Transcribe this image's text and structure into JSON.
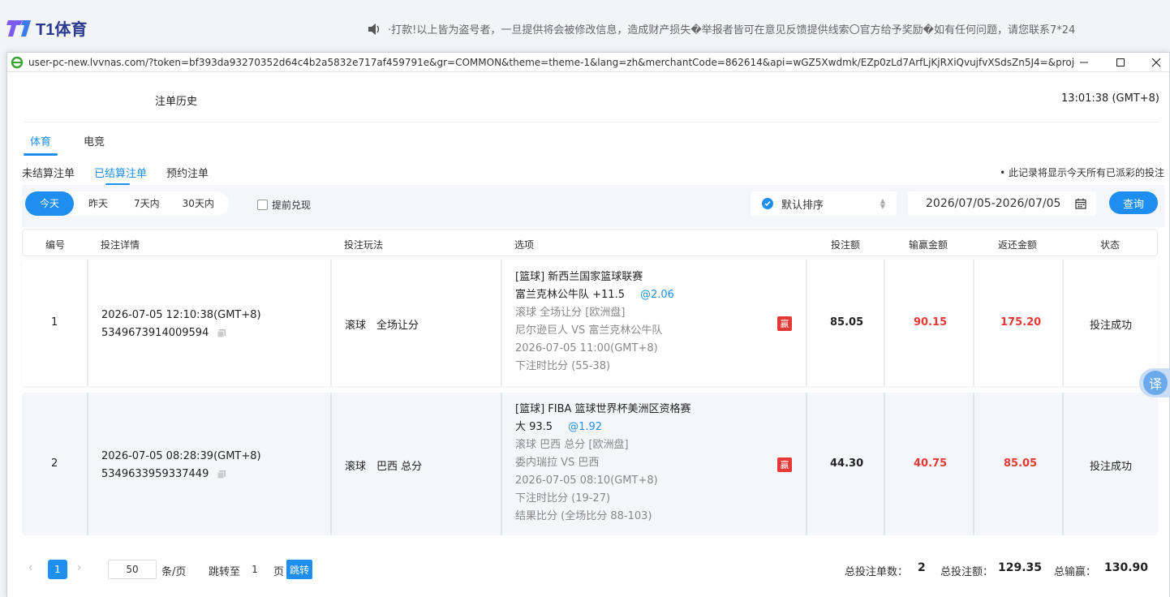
{
  "site": {
    "logo_text": "T1体育",
    "notice": "·打款!以上皆为盗号者，一旦提供将会被修改信息，造成财产损失�举报者皆可在意见反馈提供线索〇官方给予奖励�如有任何问题，请您联系7*24"
  },
  "window": {
    "url": "user-pc-new.lvvnas.com/?token=bf393da93270352d64c4b2a5832e717af459791e&gr=COMMON&theme=theme-1&lang=zh&merchantCode=862614&api=wGZ5Xwdmk/EZp0zLd7ArfLjKjRXiQvujfvXSdsZn5J4=&project=n..."
  },
  "page": {
    "title": "注单历史",
    "clock": "13:01:38 (GMT+8)",
    "main_tabs": [
      "体育",
      "电竞"
    ],
    "sub_tabs": [
      "未结算注单",
      "已结算注单",
      "预约注单"
    ],
    "hint": "• 此记录将显示今天所有已派彩的投注"
  },
  "filters": {
    "ranges": [
      "今天",
      "昨天",
      "7天内",
      "30天内"
    ],
    "early_cashout": "提前兑现",
    "sort": "默认排序",
    "date_range": "2026/07/05-2026/07/05",
    "query": "查询"
  },
  "table": {
    "headers": [
      "编号",
      "投注详情",
      "投注玩法",
      "选项",
      "投注额",
      "输赢金额",
      "返还金额",
      "状态"
    ],
    "rows": [
      {
        "no": "1",
        "time": "2026-07-05 12:10:38(GMT+8)",
        "order_id": "5349673914009594",
        "play": "滚球　全场让分",
        "league": "[篮球] 新西兰国家篮球联赛",
        "pick": "富兰克林公牛队 +11.5",
        "odds": "@2.06",
        "market": "滚球 全场让分 [欧洲盘]",
        "match": "尼尔逊巨人 VS 富兰克林公牛队",
        "match_time": "2026-07-05 11:00(GMT+8)",
        "score_at_bet": "下注时比分 (55-38)",
        "result_score": "",
        "badge": "赢",
        "stake": "85.05",
        "win_loss": "90.15",
        "return": "175.20",
        "status": "投注成功"
      },
      {
        "no": "2",
        "time": "2026-07-05 08:28:39(GMT+8)",
        "order_id": "5349633959337449",
        "play": "滚球　巴西 总分",
        "league": "[篮球] FIBA 篮球世界杯美洲区资格赛",
        "pick": "大 93.5",
        "odds": "@1.92",
        "market": "滚球 巴西 总分 [欧洲盘]",
        "match": "委内瑞拉 VS 巴西",
        "match_time": "2026-07-05 08:10(GMT+8)",
        "score_at_bet": "下注时比分 (19-27)",
        "result_score": "结果比分 (全场比分 88-103)",
        "badge": "赢",
        "stake": "44.30",
        "win_loss": "40.75",
        "return": "85.05",
        "status": "投注成功"
      }
    ]
  },
  "footer": {
    "current_page": "1",
    "page_size": "50",
    "per_page_label": "条/页",
    "jump_label": "跳转至",
    "jump_value": "1",
    "page_unit": "页",
    "jump_button": "跳转",
    "total_count_label": "总投注单数：",
    "total_count": "2",
    "total_stake_label": "总投注额：",
    "total_stake": "129.35",
    "total_win_label": "总输赢：",
    "total_win": "130.90"
  },
  "translate_label": "译",
  "colors": {
    "accent": "#1f8ef1",
    "win_red": "#e53935"
  },
  "icons": [
    "speaker-icon",
    "ie-icon",
    "minimize-icon",
    "maximize-icon",
    "close-icon",
    "check-icon",
    "calendar-icon",
    "copy-icon",
    "chevron-left-icon",
    "chevron-right-icon"
  ]
}
